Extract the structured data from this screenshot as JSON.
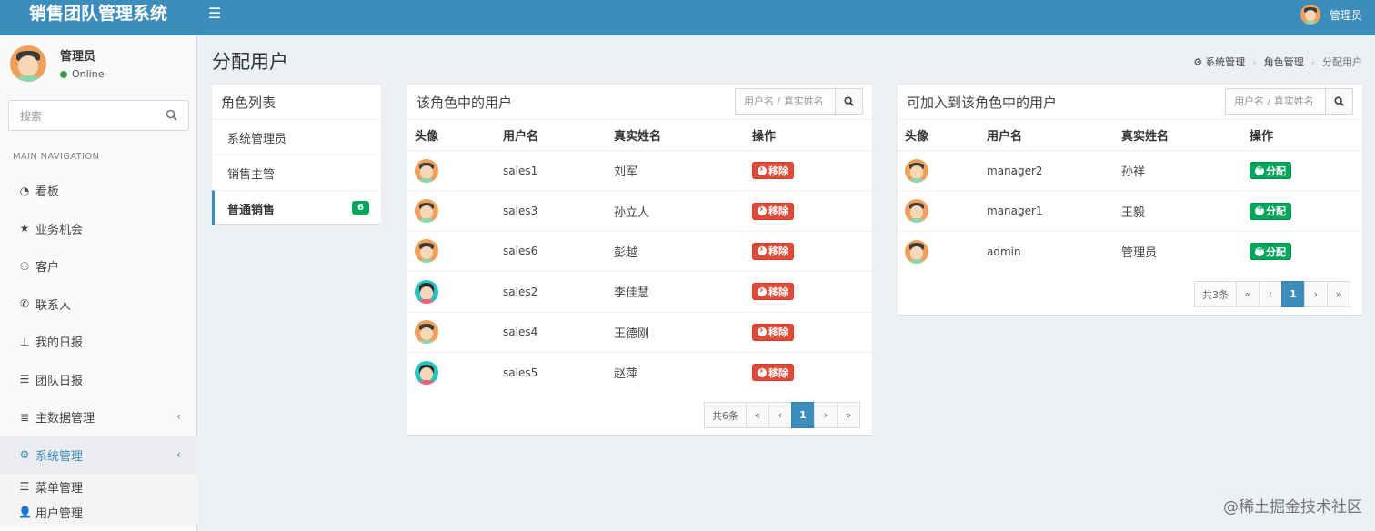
{
  "app": {
    "title": "销售团队管理系统",
    "menu_icon": "bars-icon"
  },
  "top_user": {
    "name": "管理员",
    "avatar": "orange"
  },
  "sidebar": {
    "user": {
      "name": "管理员",
      "status": "Online",
      "status_color": "#3d9a4a"
    },
    "search": {
      "placeholder": "搜索"
    },
    "nav_header": "MAIN NAVIGATION",
    "items": [
      {
        "label": "看板",
        "icon": "dashboard-icon"
      },
      {
        "label": "业务机会",
        "icon": "star-icon"
      },
      {
        "label": "客户",
        "icon": "sitemap-icon"
      },
      {
        "label": "联系人",
        "icon": "phone-icon"
      },
      {
        "label": "我的日报",
        "icon": "pin-icon"
      },
      {
        "label": "团队日报",
        "icon": "list-icon"
      },
      {
        "label": "主数据管理",
        "icon": "database-icon"
      },
      {
        "label": "系统管理",
        "icon": "cogs-icon",
        "active": true
      }
    ],
    "sub_items": [
      {
        "label": "菜单管理",
        "icon": "list-icon"
      },
      {
        "label": "用户管理",
        "icon": "user-icon"
      }
    ]
  },
  "page": {
    "title": "分配用户",
    "breadcrumb": [
      "系统管理",
      "角色管理",
      "分配用户"
    ]
  },
  "roles": {
    "title": "角色列表",
    "items": [
      {
        "label": "系统管理员"
      },
      {
        "label": "销售主管"
      },
      {
        "label": "普通销售",
        "badge": "6",
        "active": true
      }
    ]
  },
  "in_role": {
    "title": "该角色中的用户",
    "search_placeholder": "用户名 / 真实姓名",
    "columns": [
      "头像",
      "用户名",
      "真实姓名",
      "操作"
    ],
    "action_label": "移除",
    "rows": [
      {
        "username": "sales1",
        "realname": "刘军",
        "avatar": "orange"
      },
      {
        "username": "sales3",
        "realname": "孙立人",
        "avatar": "orange"
      },
      {
        "username": "sales6",
        "realname": "彭越",
        "avatar": "orange"
      },
      {
        "username": "sales2",
        "realname": "李佳慧",
        "avatar": "teal"
      },
      {
        "username": "sales4",
        "realname": "王德刚",
        "avatar": "orange"
      },
      {
        "username": "sales5",
        "realname": "赵萍",
        "avatar": "teal"
      }
    ],
    "pager": {
      "total": "共6条",
      "first": "«",
      "prev": "‹",
      "current": "1",
      "next": "›",
      "last": "»"
    }
  },
  "available": {
    "title": "可加入到该角色中的用户",
    "search_placeholder": "用户名 / 真实姓名",
    "columns": [
      "头像",
      "用户名",
      "真实姓名",
      "操作"
    ],
    "action_label": "分配",
    "rows": [
      {
        "username": "manager2",
        "realname": "孙祥",
        "avatar": "orange"
      },
      {
        "username": "manager1",
        "realname": "王毅",
        "avatar": "orange"
      },
      {
        "username": "admin",
        "realname": "管理员",
        "avatar": "orange"
      }
    ],
    "pager": {
      "total": "共3条",
      "first": "«",
      "prev": "‹",
      "current": "1",
      "next": "›",
      "last": "»"
    }
  },
  "watermark": "@稀土掘金技术社区"
}
